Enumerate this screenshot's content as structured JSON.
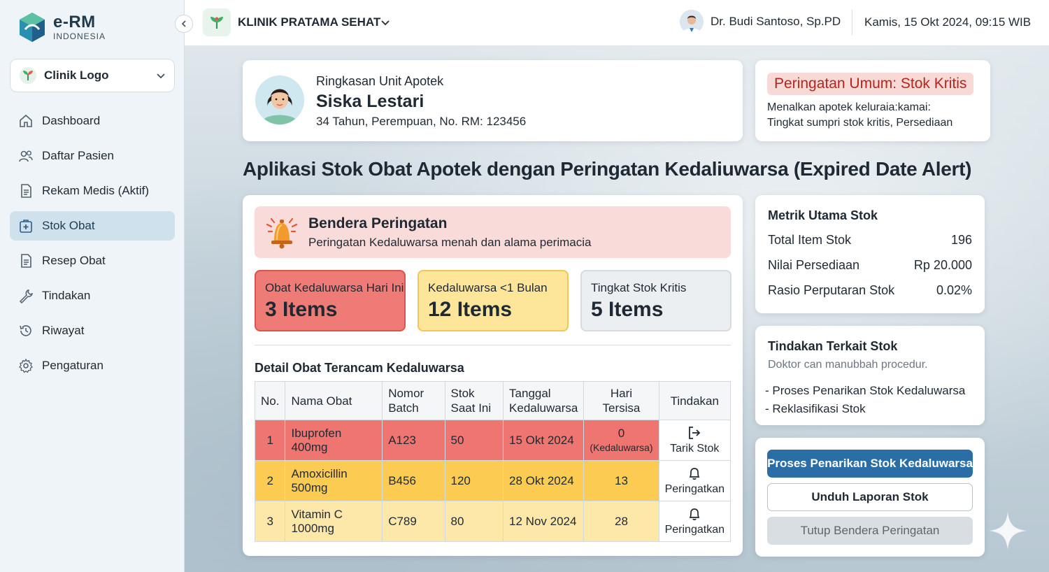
{
  "brand": {
    "name": "e-RM",
    "sub": "INDONESIA"
  },
  "sidebar": {
    "clinic_select": "Clinik Logo",
    "items": [
      {
        "label": "Dashboard",
        "icon": "home-icon"
      },
      {
        "label": "Daftar Pasien",
        "icon": "users-icon"
      },
      {
        "label": "Rekam Medis (Aktif)",
        "icon": "document-icon"
      },
      {
        "label": "Stok Obat",
        "icon": "medical-box-icon",
        "active": true
      },
      {
        "label": "Resep Obat",
        "icon": "document-icon"
      },
      {
        "label": "Tindakan",
        "icon": "wrench-icon"
      },
      {
        "label": "Riwayat",
        "icon": "history-icon"
      },
      {
        "label": "Pengaturan",
        "icon": "gear-icon"
      }
    ]
  },
  "topbar": {
    "clinic_name": "KLINIK PRATAMA SEHAT",
    "doctor": "Dr. Budi Santoso, Sp.PD",
    "datetime": "Kamis, 15 Okt 2024, 09:15 WIB"
  },
  "patient": {
    "subtitle": "Ringkasan Unit Apotek",
    "name": "Siska Lestari",
    "info": "34 Tahun, Perempuan, No. RM: 123456"
  },
  "general_warning": {
    "badge": "Peringatan Umum: Stok Kritis",
    "line1": "Menalkan apotek keluraia:kamai:",
    "line2": "Tingkat sumpri stok kritis, Persediaan"
  },
  "page_title": "Aplikasi Stok Obat Apotek dengan Peringatan Kedaliuwarsa (Expired Date Alert)",
  "flag": {
    "title": "Bendera Peringatan",
    "text": "Peringatan Kedaluwarsa menah dan alama perimacia"
  },
  "stats": {
    "expired_today": {
      "label": "Obat Kedaluwarsa Hari Ini",
      "value": "3 Items"
    },
    "expiring_month": {
      "label": "Kedaluwarsa <1 Bulan",
      "value": "12 Items"
    },
    "critical_stock": {
      "label": "Tingkat Stok Kritis",
      "value": "5 Items"
    }
  },
  "detail_title": "Detail Obat Terancam Kedaluwarsa",
  "table": {
    "headers": [
      "No.",
      "Nama Obat",
      "Nomor Batch",
      "Stok Saat Ini",
      "Tanggal Kedaluwarsa",
      "Hari Tersisa",
      "Tindakan"
    ],
    "rows": [
      {
        "no": "1",
        "name": "Ibuprofen 400mg",
        "batch": "A123",
        "stock": "50",
        "date": "15 Okt 2024",
        "days": "0",
        "days_note": "(Kedaluwarsa)",
        "action": "Tarik Stok",
        "action_icon": "logout-icon"
      },
      {
        "no": "2",
        "name": "Amoxicillin 500mg",
        "batch": "B456",
        "stock": "120",
        "date": "28 Okt 2024",
        "days": "13",
        "action": "Peringatkan",
        "action_icon": "bell-icon"
      },
      {
        "no": "3",
        "name": "Vitamin C 1000mg",
        "batch": "C789",
        "stock": "80",
        "date": "12 Nov 2024",
        "days": "28",
        "action": "Peringatkan",
        "action_icon": "bell-icon"
      }
    ]
  },
  "metrics": {
    "title": "Metrik Utama Stok",
    "rows": [
      {
        "label": "Total Item Stok",
        "value": "196"
      },
      {
        "label": "Nilai Persediaan",
        "value": "Rp 20.000"
      },
      {
        "label": "Rasio Perputaran Stok",
        "value": "0.02%"
      }
    ]
  },
  "actions": {
    "title": "Tindakan Terkait Stok",
    "note": "Doktor can manubbah procedur.",
    "items": [
      "- Proses Penarikan Stok Kedaluwarsa",
      "- Reklasifikasi Stok"
    ]
  },
  "buttons": {
    "primary": "Proses Penarikan Stok Kedaluwarsa",
    "download": "Unduh Laporan Stok",
    "close": "Tutup Bendera Peringatan"
  },
  "colors": {
    "accent": "#2b6ea6",
    "danger": "#ee7570",
    "warning": "#fccb52",
    "warning_light": "#fde8a9",
    "sidebar_active": "#cfe1ec"
  }
}
